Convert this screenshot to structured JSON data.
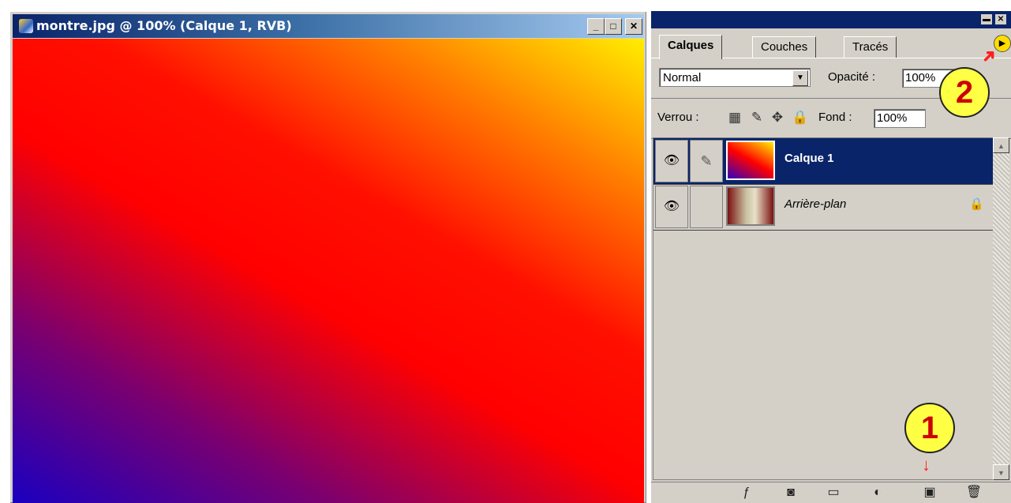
{
  "document_window": {
    "title": "montre.jpg @ 100% (Calque 1, RVB)",
    "minimize_label": "_",
    "maximize_label": "□",
    "close_label": "✕",
    "icon": "document-icon"
  },
  "layers_palette": {
    "tabs": [
      {
        "label": "Calques",
        "active": true
      },
      {
        "label": "Couches",
        "active": false
      },
      {
        "label": "Tracés",
        "active": false
      }
    ],
    "blend_mode": "Normal",
    "opacity_label": "Opacité :",
    "opacity_value": "100%",
    "lock_label": "Verrou :",
    "fill_label": "Fond :",
    "fill_value": "100%",
    "layers": [
      {
        "name": "Calque 1",
        "selected": true,
        "visible": true
      },
      {
        "name": "Arrière-plan",
        "selected": false,
        "visible": true,
        "locked": true
      }
    ],
    "bottom_icons": [
      "layer-style-icon",
      "mask-icon",
      "folder-icon",
      "adjustment-icon",
      "new-layer-icon",
      "trash-icon"
    ]
  },
  "callouts": [
    {
      "number": "1"
    },
    {
      "number": "2"
    }
  ],
  "colors": {
    "titlebar_dark": "#0a246a",
    "titlebar_light": "#a6caf0",
    "selected_layer": "#0a246a",
    "panel_bg": "#d4d0c8",
    "callout_fill": "#ffff44",
    "callout_text": "#cc0000"
  }
}
